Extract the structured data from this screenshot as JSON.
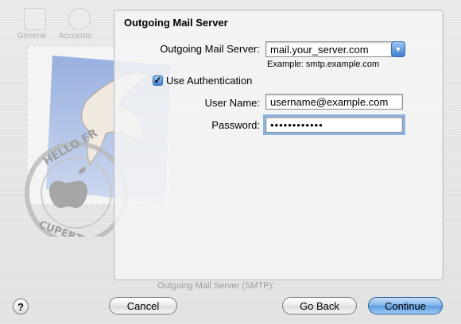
{
  "toolbar_ghost": {
    "items": [
      "General",
      "Accounts"
    ]
  },
  "panel": {
    "title": "Outgoing Mail Server",
    "server_label": "Outgoing Mail Server:",
    "server_value": "mail.your_server.com",
    "example_hint": "Example: smtp.example.com",
    "use_auth_label": "Use Authentication",
    "use_auth_checked": true,
    "username_label": "User Name:",
    "username_value": "username@example.com",
    "password_label": "Password:",
    "password_value": "••••••••••••"
  },
  "footer_ghost": "Outgoing Mail Server (SMTP):",
  "buttons": {
    "help": "?",
    "cancel": "Cancel",
    "back": "Go Back",
    "continue": "Continue"
  },
  "stamp_text": {
    "top": "HELLO FR",
    "bottom": "CUPERTINO CA"
  }
}
